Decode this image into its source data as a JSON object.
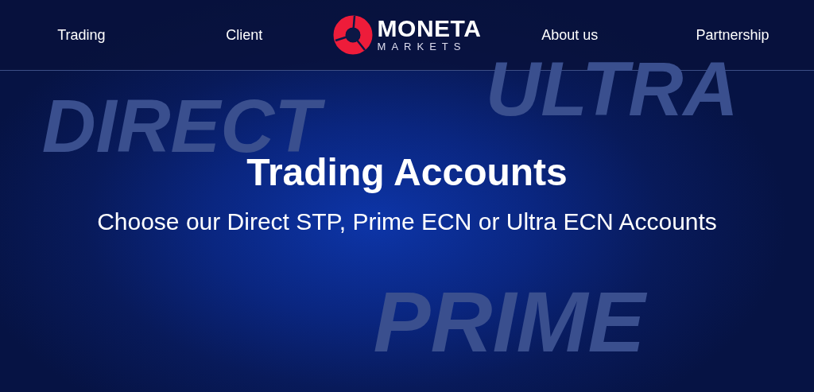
{
  "nav": {
    "items": [
      {
        "label": "Trading"
      },
      {
        "label": "Client"
      },
      {
        "kind": "logo",
        "name": "MONETA",
        "tagline": "MARKETS"
      },
      {
        "label": "About us"
      },
      {
        "label": "Partnership"
      }
    ]
  },
  "hero": {
    "background_words": [
      "DIRECT",
      "ULTRA",
      "PRIME"
    ],
    "title": "Trading Accounts",
    "subtitle": "Choose our Direct STP, Prime ECN or Ultra ECN Accounts"
  }
}
